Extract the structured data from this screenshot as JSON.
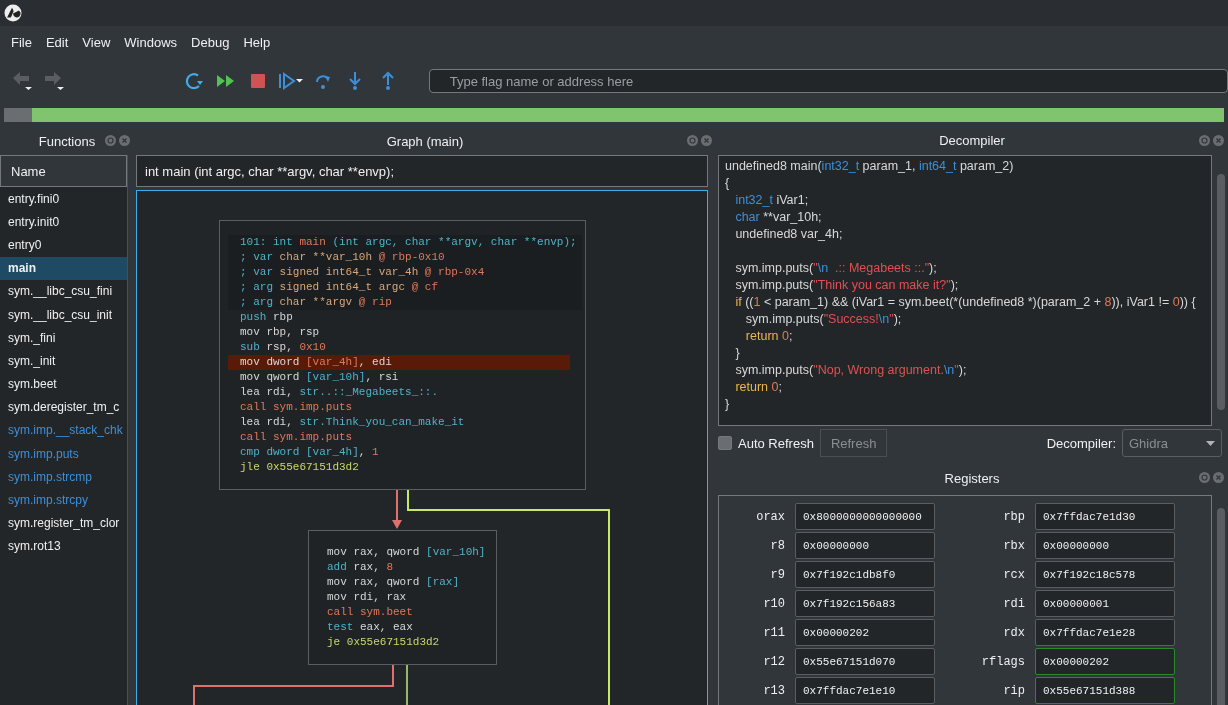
{
  "menu": [
    "File",
    "Edit",
    "View",
    "Windows",
    "Debug",
    "Help"
  ],
  "toolbar": {
    "search": {
      "placeholder": "Type flag name or address here"
    }
  },
  "functions": {
    "title": "Functions",
    "column": "Name",
    "items": [
      {
        "name": "entry.fini0",
        "kind": "local",
        "selected": false
      },
      {
        "name": "entry.init0",
        "kind": "local",
        "selected": false
      },
      {
        "name": "entry0",
        "kind": "local",
        "selected": false
      },
      {
        "name": "main",
        "kind": "local",
        "selected": true
      },
      {
        "name": "sym.__libc_csu_fini",
        "kind": "local",
        "selected": false
      },
      {
        "name": "sym.__libc_csu_init",
        "kind": "local",
        "selected": false
      },
      {
        "name": "sym._fini",
        "kind": "local",
        "selected": false
      },
      {
        "name": "sym._init",
        "kind": "local",
        "selected": false
      },
      {
        "name": "sym.beet",
        "kind": "local",
        "selected": false
      },
      {
        "name": "sym.deregister_tm_c",
        "kind": "local",
        "selected": false
      },
      {
        "name": "sym.imp.__stack_chk",
        "kind": "import",
        "selected": false
      },
      {
        "name": "sym.imp.puts",
        "kind": "import",
        "selected": false
      },
      {
        "name": "sym.imp.strcmp",
        "kind": "import",
        "selected": false
      },
      {
        "name": "sym.imp.strcpy",
        "kind": "import",
        "selected": false
      },
      {
        "name": "sym.register_tm_clor",
        "kind": "local",
        "selected": false
      },
      {
        "name": "sym.rot13",
        "kind": "local",
        "selected": false
      }
    ]
  },
  "graph": {
    "title": "Graph (main)",
    "signature": "int main (int argc, char **argv, char **envp);",
    "blocks": [
      {
        "header": [
          [
            {
              "kind": "keyword",
              "text": "101: int "
            },
            {
              "kind": "call",
              "text": "main"
            },
            {
              "kind": "keyword",
              "text": " (int argc, char **argv, char **envp);"
            }
          ],
          [
            {
              "kind": "keyword",
              "text": "; var "
            },
            {
              "kind": "variable",
              "text": "char **var_10h "
            },
            {
              "kind": "call",
              "text": "@ rbp-0x10"
            }
          ],
          [
            {
              "kind": "keyword",
              "text": "; var "
            },
            {
              "kind": "variable",
              "text": "signed int64_t var_4h "
            },
            {
              "kind": "call",
              "text": "@ rbp-0x4"
            }
          ],
          [
            {
              "kind": "keyword",
              "text": "; arg "
            },
            {
              "kind": "variable",
              "text": "signed int64_t argc "
            },
            {
              "kind": "call",
              "text": "@ cf"
            }
          ],
          [
            {
              "kind": "keyword",
              "text": "; arg "
            },
            {
              "kind": "variable",
              "text": "char **argv "
            },
            {
              "kind": "call",
              "text": "@ rip"
            }
          ]
        ],
        "lines": [
          {
            "highlighted": false,
            "tokens": [
              {
                "kind": "keyword",
                "text": "push "
              },
              {
                "kind": "plain",
                "text": "rbp"
              }
            ]
          },
          {
            "highlighted": false,
            "tokens": [
              {
                "kind": "plain",
                "text": "mov rbp, rsp"
              }
            ]
          },
          {
            "highlighted": false,
            "tokens": [
              {
                "kind": "keyword",
                "text": "sub "
              },
              {
                "kind": "plain",
                "text": "rsp, "
              },
              {
                "kind": "number",
                "text": "0x10"
              }
            ]
          },
          {
            "highlighted": true,
            "tokens": [
              {
                "kind": "plain",
                "text": "mov dword "
              },
              {
                "kind": "number",
                "text": "[var_4h]"
              },
              {
                "kind": "plain",
                "text": ", edi"
              }
            ]
          },
          {
            "highlighted": false,
            "tokens": [
              {
                "kind": "plain",
                "text": "mov qword "
              },
              {
                "kind": "keyword",
                "text": "[var_10h]"
              },
              {
                "kind": "plain",
                "text": ", rsi"
              }
            ]
          },
          {
            "highlighted": false,
            "tokens": [
              {
                "kind": "plain",
                "text": "lea rdi, "
              },
              {
                "kind": "keyword",
                "text": "str..::_Megabeets_::."
              }
            ]
          },
          {
            "highlighted": false,
            "tokens": [
              {
                "kind": "call",
                "text": "call sym.imp.puts"
              }
            ]
          },
          {
            "highlighted": false,
            "tokens": [
              {
                "kind": "plain",
                "text": "lea rdi, "
              },
              {
                "kind": "keyword",
                "text": "str.Think_you_can_make_it"
              }
            ]
          },
          {
            "highlighted": false,
            "tokens": [
              {
                "kind": "call",
                "text": "call sym.imp.puts"
              }
            ]
          },
          {
            "highlighted": false,
            "tokens": [
              {
                "kind": "keyword",
                "text": "cmp dword [var_4h]"
              },
              {
                "kind": "plain",
                "text": ", "
              },
              {
                "kind": "number",
                "text": "1"
              }
            ]
          },
          {
            "highlighted": false,
            "tokens": [
              {
                "kind": "jump",
                "text": "jle 0x55e67151d3d2"
              }
            ]
          }
        ]
      },
      {
        "lines": [
          {
            "highlighted": false,
            "tokens": [
              {
                "kind": "plain",
                "text": "mov rax, qword "
              },
              {
                "kind": "keyword",
                "text": "[var_10h]"
              }
            ]
          },
          {
            "highlighted": false,
            "tokens": [
              {
                "kind": "keyword",
                "text": "add "
              },
              {
                "kind": "plain",
                "text": "rax, "
              },
              {
                "kind": "number",
                "text": "8"
              }
            ]
          },
          {
            "highlighted": false,
            "tokens": [
              {
                "kind": "plain",
                "text": "mov rax, qword "
              },
              {
                "kind": "keyword",
                "text": "[rax]"
              }
            ]
          },
          {
            "highlighted": false,
            "tokens": [
              {
                "kind": "plain",
                "text": "mov rdi, rax"
              }
            ]
          },
          {
            "highlighted": false,
            "tokens": [
              {
                "kind": "call",
                "text": "call sym.beet"
              }
            ]
          },
          {
            "highlighted": false,
            "tokens": [
              {
                "kind": "keyword",
                "text": "test "
              },
              {
                "kind": "plain",
                "text": "eax, eax"
              }
            ]
          },
          {
            "highlighted": false,
            "tokens": [
              {
                "kind": "jump",
                "text": "je 0x55e67151d3d2"
              }
            ]
          }
        ]
      }
    ]
  },
  "decompiler": {
    "title": "Decompiler",
    "lines": [
      {
        "kind": "code",
        "tokens": [
          {
            "kind": "plain",
            "text": "undefined8 main("
          },
          {
            "kind": "type",
            "text": "int32_t"
          },
          {
            "kind": "plain",
            "text": " param_1, "
          },
          {
            "kind": "type",
            "text": "int64_t"
          },
          {
            "kind": "plain",
            "text": " param_2)"
          }
        ]
      },
      {
        "kind": "code",
        "tokens": [
          {
            "kind": "plain",
            "text": "{"
          }
        ]
      },
      {
        "kind": "code",
        "tokens": [
          {
            "kind": "type",
            "text": "   int32_t"
          },
          {
            "kind": "plain",
            "text": " iVar1;"
          }
        ]
      },
      {
        "kind": "code",
        "tokens": [
          {
            "kind": "type",
            "text": "   char"
          },
          {
            "kind": "plain",
            "text": " **var_10h;"
          }
        ]
      },
      {
        "kind": "code",
        "tokens": [
          {
            "kind": "plain",
            "text": "   undefined8 var_4h;"
          }
        ]
      },
      {
        "kind": "blank"
      },
      {
        "kind": "code",
        "tokens": [
          {
            "kind": "plain",
            "text": "   sym.imp.puts("
          },
          {
            "kind": "string",
            "text": "\""
          },
          {
            "kind": "type",
            "text": "\\n"
          },
          {
            "kind": "string",
            "text": "  .:: Megabeets ::.\""
          },
          {
            "kind": "plain",
            "text": ");"
          }
        ]
      },
      {
        "kind": "code",
        "tokens": [
          {
            "kind": "plain",
            "text": "   sym.imp.puts("
          },
          {
            "kind": "string",
            "text": "\"Think you can make it?\""
          },
          {
            "kind": "plain",
            "text": ");"
          }
        ]
      },
      {
        "kind": "code",
        "tokens": [
          {
            "kind": "control",
            "text": "   if"
          },
          {
            "kind": "plain",
            "text": " (("
          },
          {
            "kind": "number",
            "text": "1"
          },
          {
            "kind": "plain",
            "text": " < param_1) && (iVar1 = sym.beet(*(undefined8 *)(param_2 + "
          },
          {
            "kind": "number",
            "text": "8"
          },
          {
            "kind": "plain",
            "text": ")), iVar1 != "
          },
          {
            "kind": "number",
            "text": "0"
          },
          {
            "kind": "plain",
            "text": ")) {"
          }
        ]
      },
      {
        "kind": "code",
        "tokens": [
          {
            "kind": "plain",
            "text": "      sym.imp.puts("
          },
          {
            "kind": "string",
            "text": "\"Success!"
          },
          {
            "kind": "type",
            "text": "\\n"
          },
          {
            "kind": "string",
            "text": "\""
          },
          {
            "kind": "plain",
            "text": ");"
          }
        ]
      },
      {
        "kind": "code",
        "tokens": [
          {
            "kind": "control",
            "text": "      return"
          },
          {
            "kind": "number",
            "text": " 0"
          },
          {
            "kind": "plain",
            "text": ";"
          }
        ]
      },
      {
        "kind": "code",
        "tokens": [
          {
            "kind": "plain",
            "text": "   }"
          }
        ]
      },
      {
        "kind": "code",
        "tokens": [
          {
            "kind": "plain",
            "text": "   sym.imp.puts("
          },
          {
            "kind": "string",
            "text": "\"Nop, Wrong argument."
          },
          {
            "kind": "type",
            "text": "\\n"
          },
          {
            "kind": "string",
            "text": "\""
          },
          {
            "kind": "plain",
            "text": ");"
          }
        ]
      },
      {
        "kind": "code",
        "tokens": [
          {
            "kind": "control",
            "text": "   return"
          },
          {
            "kind": "number",
            "text": " 0"
          },
          {
            "kind": "plain",
            "text": ";"
          }
        ]
      },
      {
        "kind": "code",
        "tokens": [
          {
            "kind": "plain",
            "text": "}"
          }
        ]
      }
    ],
    "auto_refresh": {
      "label": "Auto Refresh",
      "checked": false
    },
    "refresh_button": {
      "label": "Refresh",
      "disabled": true
    },
    "engine": {
      "label": "Decompiler:",
      "value": "Ghidra",
      "disabled": true
    }
  },
  "registers": {
    "title": "Registers",
    "rows": [
      [
        {
          "name": "orax",
          "value": "0x8000000000000000",
          "changed": false
        },
        {
          "name": "rbp",
          "value": "0x7ffdac7e1d30",
          "changed": false
        }
      ],
      [
        {
          "name": "r8",
          "value": "0x00000000",
          "changed": false
        },
        {
          "name": "rbx",
          "value": "0x00000000",
          "changed": false
        }
      ],
      [
        {
          "name": "r9",
          "value": "0x7f192c1db8f0",
          "changed": false
        },
        {
          "name": "rcx",
          "value": "0x7f192c18c578",
          "changed": false
        }
      ],
      [
        {
          "name": "r10",
          "value": "0x7f192c156a83",
          "changed": false
        },
        {
          "name": "rdi",
          "value": "0x00000001",
          "changed": false
        }
      ],
      [
        {
          "name": "r11",
          "value": "0x00000202",
          "changed": false
        },
        {
          "name": "rdx",
          "value": "0x7ffdac7e1e28",
          "changed": false
        }
      ],
      [
        {
          "name": "r12",
          "value": "0x55e67151d070",
          "changed": false
        },
        {
          "name": "rflags",
          "value": "0x00000202",
          "changed": true
        }
      ],
      [
        {
          "name": "r13",
          "value": "0x7ffdac7e1e10",
          "changed": false
        },
        {
          "name": "rip",
          "value": "0x55e67151d388",
          "changed": true
        }
      ]
    ]
  }
}
